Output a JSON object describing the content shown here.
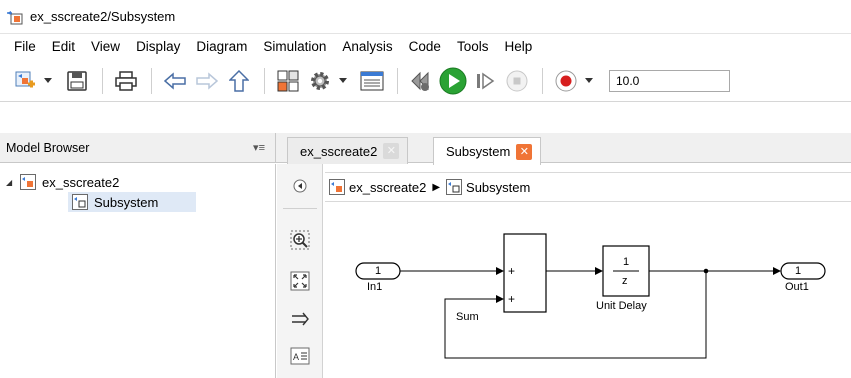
{
  "window": {
    "title": "ex_sscreate2/Subsystem"
  },
  "menu": [
    "File",
    "Edit",
    "View",
    "Display",
    "Diagram",
    "Simulation",
    "Analysis",
    "Code",
    "Tools",
    "Help"
  ],
  "toolbar": {
    "stop_time": "10.0"
  },
  "model_browser": {
    "header": "Model Browser",
    "menu_glyph": "▾≡",
    "tree": [
      {
        "label": "ex_sscreate2",
        "expanded": true
      },
      {
        "label": "Subsystem",
        "selected": true
      }
    ]
  },
  "tabs": [
    {
      "label": "ex_sscreate2",
      "active": false
    },
    {
      "label": "Subsystem",
      "active": true
    }
  ],
  "breadcrumb": {
    "root": "ex_sscreate2",
    "separator": "▶",
    "current": "Subsystem"
  },
  "diagram": {
    "in_port": {
      "number": "1",
      "name": "In1"
    },
    "sum": {
      "name": "Sum",
      "signs": [
        "+",
        "+"
      ]
    },
    "delay": {
      "numerator": "1",
      "denominator": "z",
      "name": "Unit Delay"
    },
    "out_port": {
      "number": "1",
      "name": "Out1"
    }
  },
  "colors": {
    "accent_orange": "#f07436",
    "run_green": "#2aa234",
    "record_red": "#d71f1f",
    "selection_blue": "#dfe9f6"
  }
}
